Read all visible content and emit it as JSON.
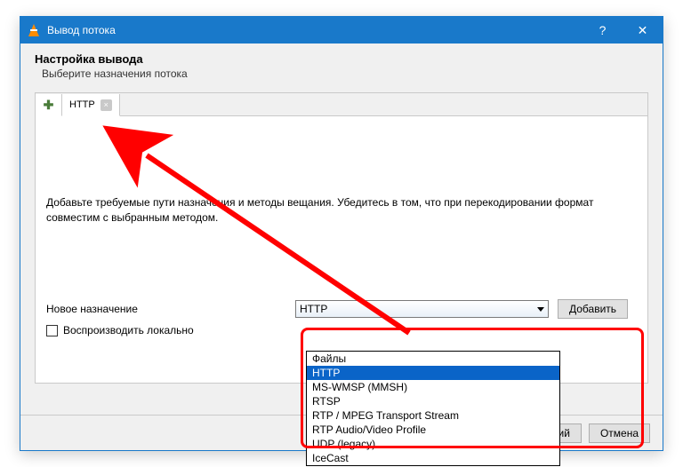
{
  "titlebar": {
    "title": "Вывод потока"
  },
  "section": {
    "title": "Настройка вывода",
    "subtitle": "Выберите назначения потока"
  },
  "tabs": {
    "http_label": "HTTP"
  },
  "instruction": "Добавьте требуемые пути назначения и методы вещания. Убедитесь в том, что при перекодировании формат совместим с выбранным методом.",
  "newdest": {
    "label": "Новое назначение",
    "combo_value": "HTTP",
    "add_label": "Добавить"
  },
  "checkbox": {
    "label": "Воспроизводить локально"
  },
  "buttons": {
    "next": "щий",
    "cancel": "Отмена"
  },
  "dropdown": {
    "options": [
      "Файлы",
      "HTTP",
      "MS-WMSP (MMSH)",
      "RTSP",
      "RTP / MPEG Transport Stream",
      "RTP Audio/Video Profile",
      "UDP (legacy)",
      "IceCast"
    ],
    "selected_index": 1
  },
  "colors": {
    "accent": "#1979ca",
    "highlight": "#ff0000"
  }
}
